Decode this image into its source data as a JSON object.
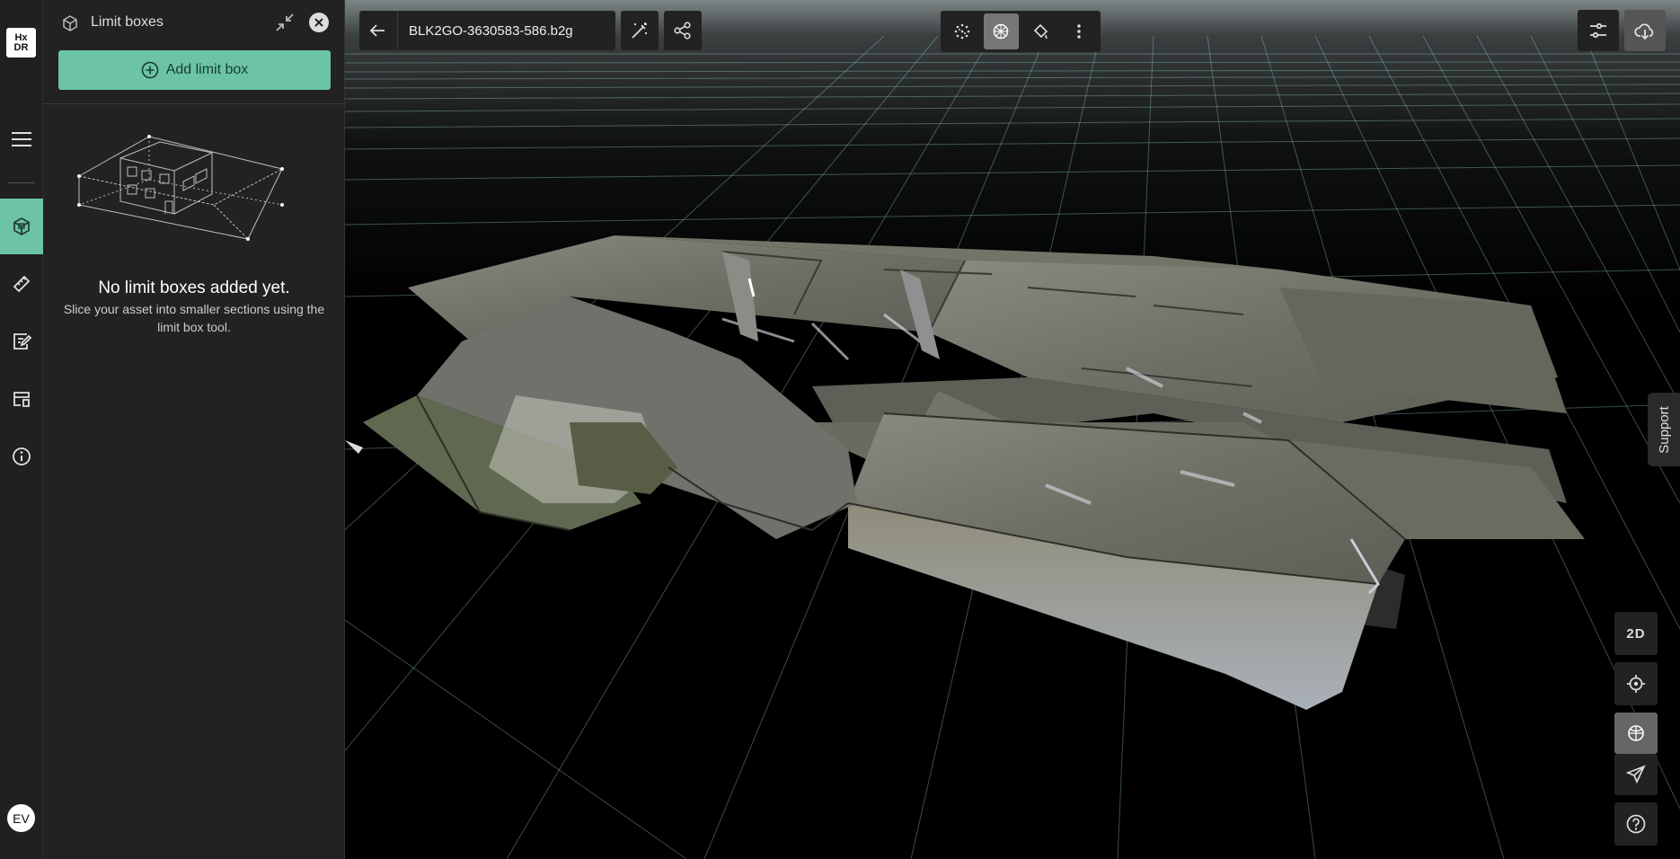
{
  "rail": {
    "logo_top": "Hx",
    "logo_bottom": "DR",
    "avatar_initials": "EV"
  },
  "panel": {
    "title": "Limit boxes",
    "add_button_label": "Add limit box",
    "empty_title": "No limit boxes added yet.",
    "empty_description": "Slice your asset into smaller sections using the limit box tool."
  },
  "toolbar": {
    "file_name": "BLK2GO-3630583-586.b2g"
  },
  "view_controls": {
    "two_d_label": "2D"
  },
  "support": {
    "label": "Support"
  },
  "colors": {
    "accent": "#6cc4a4",
    "rail_bg": "#202020",
    "panel_bg": "#222222",
    "grid_line": "#9fe0d0"
  }
}
